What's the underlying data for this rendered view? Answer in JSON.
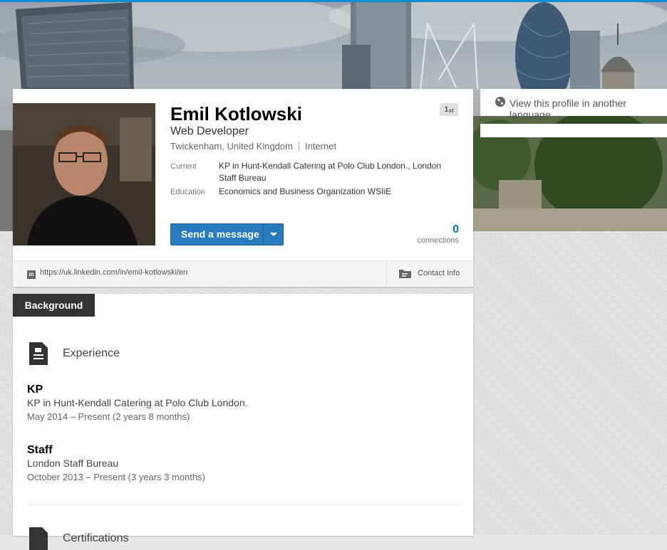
{
  "sidebar": {
    "translate_label": "View this profile in another language"
  },
  "profile": {
    "name": "Emil Kotlowski",
    "degree": "1",
    "degree_suffix": "st",
    "headline": "Web Developer",
    "location": "Twickenham, United Kingdom",
    "industry": "Internet",
    "current_label": "Current",
    "current_value": "KP in Hunt-Kendall Catering at Polo Club London., London Staff Bureau",
    "education_label": "Education",
    "education_value": "Economics and Business Organization WSIiE",
    "message_button": "Send a message",
    "connections_count": "0",
    "connections_label": "connections",
    "public_url": "https://uk.linkedin.com/in/emil-kotlowski/en",
    "contact_info_label": "Contact Info",
    "linkedin_badge": "in"
  },
  "background": {
    "tab_label": "Background",
    "experience_title": "Experience",
    "positions": [
      {
        "title": "KP",
        "company": "KP in Hunt-Kendall Catering at Polo Club London.",
        "dates": "May 2014 – Present (2 years 8 months)"
      },
      {
        "title": "Staff",
        "company": "London Staff Bureau",
        "dates": "October 2013 – Present (3 years 3 months)"
      }
    ],
    "certifications_title": "Certifications"
  },
  "colors": {
    "accent": "#0a8fd4",
    "button": "#287bbc",
    "link": "#0077b5",
    "tab_bg": "#333333"
  },
  "icons": [
    "globe-icon",
    "caret-down-icon",
    "linkedin-icon",
    "contact-card-icon",
    "experience-icon",
    "certifications-icon"
  ]
}
